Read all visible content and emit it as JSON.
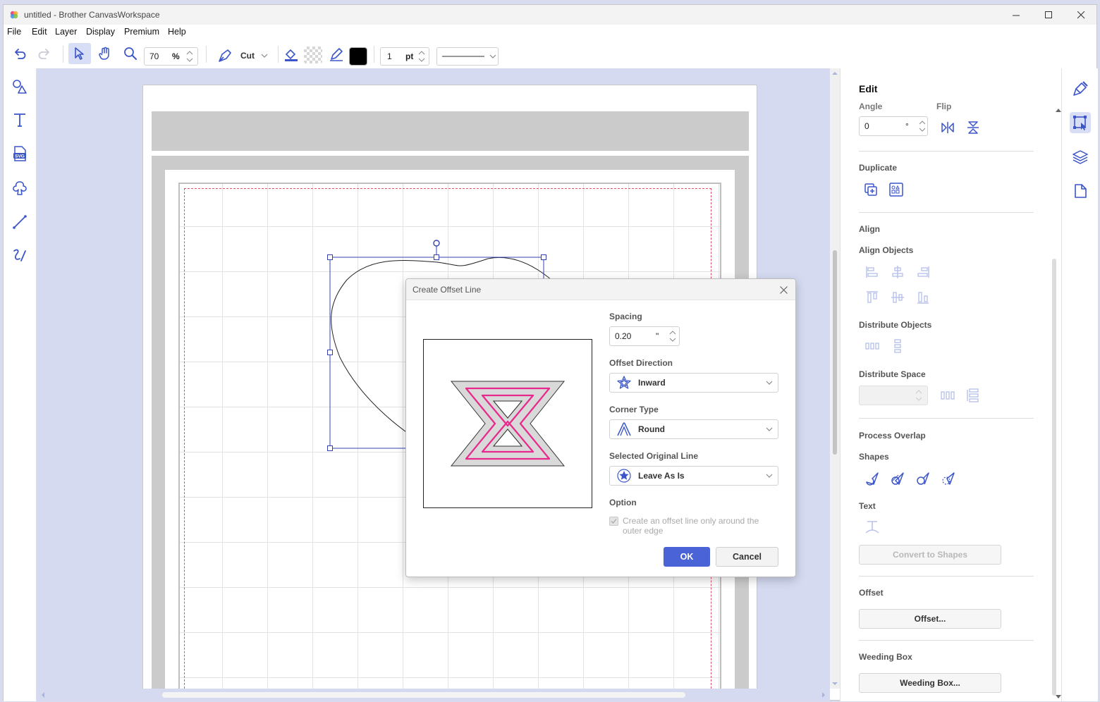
{
  "window": {
    "title": "untitled - Brother CanvasWorkspace"
  },
  "menu": [
    "File",
    "Edit",
    "Layer",
    "Display",
    "Premium",
    "Help"
  ],
  "toolbar": {
    "zoom_value": "70",
    "zoom_unit": "%",
    "mode_label": "Cut",
    "line_width_value": "1",
    "line_width_unit": "pt",
    "line_color": "#000000"
  },
  "left_tools": [
    "shapes-icon",
    "text-icon",
    "svg-icon",
    "pattern-icon",
    "line-icon",
    "draw-icon"
  ],
  "right_panel": {
    "title": "Edit",
    "angle_label": "Angle",
    "angle_value": "0",
    "angle_unit": "°",
    "flip_label": "Flip",
    "duplicate_label": "Duplicate",
    "align_label": "Align",
    "align_objects_label": "Align Objects",
    "distribute_objects_label": "Distribute Objects",
    "distribute_space_label": "Distribute Space",
    "process_overlap_label": "Process Overlap",
    "shapes_label": "Shapes",
    "text_label": "Text",
    "convert_to_shapes_label": "Convert to Shapes",
    "offset_label": "Offset",
    "offset_button": "Offset...",
    "weeding_box_label": "Weeding Box",
    "weeding_box_button": "Weeding Box..."
  },
  "dialog": {
    "title": "Create Offset Line",
    "spacing_label": "Spacing",
    "spacing_value": "0.20",
    "spacing_unit": "\"",
    "offset_direction_label": "Offset Direction",
    "offset_direction_value": "Inward",
    "corner_type_label": "Corner Type",
    "corner_type_value": "Round",
    "selected_original_line_label": "Selected Original Line",
    "selected_original_line_value": "Leave As Is",
    "option_label": "Option",
    "option_checkbox_text": "Create an offset line only around the outer edge",
    "ok_label": "OK",
    "cancel_label": "Cancel"
  },
  "colors": {
    "accent": "#4a63d6",
    "icon_blue": "#3a55c8",
    "offset_line_pink": "#e8288c",
    "canvas_bg": "#d5daf1"
  }
}
